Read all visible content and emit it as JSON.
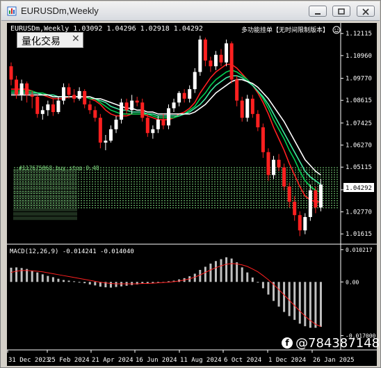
{
  "window": {
    "title": "EURUSDm,Weekly"
  },
  "chart": {
    "header": "EURUSDm,Weekly  1.03092 1.04296 1.02918 1.04292",
    "ea_label": "多功能挂单【无时间限制版本】",
    "widget_label": "量化交易",
    "widget_close": "✕",
    "price_badge": "1.04292",
    "macd_label": "MACD(12,26,9) -0.014241 -0.014040",
    "watermark": "@784387148",
    "order_label_fragments": [
      "#117675868 buy stop 0.48"
    ]
  },
  "chart_data": {
    "type": "candlestick",
    "price_axis": {
      "ticks": [
        "1.12115",
        "1.10960",
        "1.09770",
        "1.08615",
        "1.07425",
        "1.06270",
        "1.05115",
        "1.03925",
        "1.02770",
        "1.01615"
      ],
      "ylim": [
        1.0115,
        1.1245
      ]
    },
    "macd_axis": {
      "ticks": [
        "0.010217",
        "0.00",
        "-0.017000"
      ],
      "ylim": [
        -0.0215,
        0.0115
      ]
    },
    "time_axis": [
      "31 Dec 2023",
      "25 Feb 2024",
      "21 Apr 2024",
      "16 Jun 2024",
      "11 Aug 2024",
      "6 Oct 2024",
      "1 Dec 2024",
      "26 Jan 2025"
    ],
    "candles": [
      {
        "o": 1.104,
        "c": 1.097,
        "h": 1.106,
        "l": 1.094
      },
      {
        "o": 1.097,
        "c": 1.089,
        "h": 1.099,
        "l": 1.087
      },
      {
        "o": 1.089,
        "c": 1.095,
        "h": 1.097,
        "l": 1.086
      },
      {
        "o": 1.095,
        "c": 1.089,
        "h": 1.096,
        "l": 1.085
      },
      {
        "o": 1.089,
        "c": 1.088,
        "h": 1.091,
        "l": 1.082
      },
      {
        "o": 1.088,
        "c": 1.079,
        "h": 1.089,
        "l": 1.077
      },
      {
        "o": 1.079,
        "c": 1.081,
        "h": 1.083,
        "l": 1.076
      },
      {
        "o": 1.081,
        "c": 1.084,
        "h": 1.086,
        "l": 1.078
      },
      {
        "o": 1.084,
        "c": 1.08,
        "h": 1.087,
        "l": 1.078
      },
      {
        "o": 1.08,
        "c": 1.086,
        "h": 1.088,
        "l": 1.079
      },
      {
        "o": 1.086,
        "c": 1.093,
        "h": 1.095,
        "l": 1.084
      },
      {
        "o": 1.093,
        "c": 1.089,
        "h": 1.095,
        "l": 1.087
      },
      {
        "o": 1.089,
        "c": 1.087,
        "h": 1.092,
        "l": 1.085
      },
      {
        "o": 1.087,
        "c": 1.091,
        "h": 1.093,
        "l": 1.086
      },
      {
        "o": 1.091,
        "c": 1.084,
        "h": 1.092,
        "l": 1.082
      },
      {
        "o": 1.084,
        "c": 1.081,
        "h": 1.086,
        "l": 1.079
      },
      {
        "o": 1.081,
        "c": 1.077,
        "h": 1.083,
        "l": 1.075
      },
      {
        "o": 1.077,
        "c": 1.064,
        "h": 1.079,
        "l": 1.061
      },
      {
        "o": 1.064,
        "c": 1.065,
        "h": 1.068,
        "l": 1.06
      },
      {
        "o": 1.065,
        "c": 1.071,
        "h": 1.073,
        "l": 1.064
      },
      {
        "o": 1.071,
        "c": 1.076,
        "h": 1.078,
        "l": 1.069
      },
      {
        "o": 1.076,
        "c": 1.085,
        "h": 1.087,
        "l": 1.074
      },
      {
        "o": 1.085,
        "c": 1.081,
        "h": 1.087,
        "l": 1.079
      },
      {
        "o": 1.081,
        "c": 1.086,
        "h": 1.089,
        "l": 1.079
      },
      {
        "o": 1.086,
        "c": 1.085,
        "h": 1.088,
        "l": 1.083
      },
      {
        "o": 1.085,
        "c": 1.077,
        "h": 1.087,
        "l": 1.075
      },
      {
        "o": 1.077,
        "c": 1.069,
        "h": 1.079,
        "l": 1.067
      },
      {
        "o": 1.069,
        "c": 1.071,
        "h": 1.073,
        "l": 1.066
      },
      {
        "o": 1.071,
        "c": 1.076,
        "h": 1.078,
        "l": 1.069
      },
      {
        "o": 1.076,
        "c": 1.073,
        "h": 1.079,
        "l": 1.071
      },
      {
        "o": 1.073,
        "c": 1.082,
        "h": 1.084,
        "l": 1.071
      },
      {
        "o": 1.082,
        "c": 1.085,
        "h": 1.087,
        "l": 1.08
      },
      {
        "o": 1.085,
        "c": 1.09,
        "h": 1.091,
        "l": 1.083
      },
      {
        "o": 1.09,
        "c": 1.087,
        "h": 1.092,
        "l": 1.085
      },
      {
        "o": 1.087,
        "c": 1.092,
        "h": 1.094,
        "l": 1.085
      },
      {
        "o": 1.092,
        "c": 1.101,
        "h": 1.103,
        "l": 1.09
      },
      {
        "o": 1.101,
        "c": 1.118,
        "h": 1.12,
        "l": 1.099
      },
      {
        "o": 1.118,
        "c": 1.107,
        "h": 1.119,
        "l": 1.104
      },
      {
        "o": 1.107,
        "c": 1.104,
        "h": 1.109,
        "l": 1.101
      },
      {
        "o": 1.104,
        "c": 1.11,
        "h": 1.112,
        "l": 1.102
      },
      {
        "o": 1.11,
        "c": 1.106,
        "h": 1.113,
        "l": 1.104
      },
      {
        "o": 1.106,
        "c": 1.116,
        "h": 1.118,
        "l": 1.104
      },
      {
        "o": 1.116,
        "c": 1.097,
        "h": 1.117,
        "l": 1.095
      },
      {
        "o": 1.097,
        "c": 1.086,
        "h": 1.099,
        "l": 1.083
      },
      {
        "o": 1.086,
        "c": 1.077,
        "h": 1.088,
        "l": 1.075
      },
      {
        "o": 1.077,
        "c": 1.087,
        "h": 1.089,
        "l": 1.075
      },
      {
        "o": 1.087,
        "c": 1.079,
        "h": 1.089,
        "l": 1.077
      },
      {
        "o": 1.079,
        "c": 1.072,
        "h": 1.081,
        "l": 1.07
      },
      {
        "o": 1.072,
        "c": 1.059,
        "h": 1.074,
        "l": 1.056
      },
      {
        "o": 1.059,
        "c": 1.047,
        "h": 1.061,
        "l": 1.044
      },
      {
        "o": 1.047,
        "c": 1.055,
        "h": 1.057,
        "l": 1.045
      },
      {
        "o": 1.055,
        "c": 1.051,
        "h": 1.058,
        "l": 1.049
      },
      {
        "o": 1.051,
        "c": 1.041,
        "h": 1.053,
        "l": 1.039
      },
      {
        "o": 1.041,
        "c": 1.033,
        "h": 1.043,
        "l": 1.03
      },
      {
        "o": 1.033,
        "c": 1.026,
        "h": 1.036,
        "l": 1.023
      },
      {
        "o": 1.026,
        "c": 1.018,
        "h": 1.028,
        "l": 1.015
      },
      {
        "o": 1.018,
        "c": 1.025,
        "h": 1.027,
        "l": 1.016
      },
      {
        "o": 1.025,
        "c": 1.039,
        "h": 1.042,
        "l": 1.023
      },
      {
        "o": 1.039,
        "c": 1.03,
        "h": 1.041,
        "l": 1.027
      },
      {
        "o": 1.03,
        "c": 1.042,
        "h": 1.045,
        "l": 1.028
      }
    ],
    "moving_averages": [
      {
        "color": "#ff2020",
        "values": [
          1.092,
          1.092,
          1.092,
          1.092,
          1.091,
          1.09,
          1.089,
          1.088,
          1.087,
          1.087,
          1.087,
          1.088,
          1.088,
          1.088,
          1.088,
          1.087,
          1.086,
          1.084,
          1.081,
          1.079,
          1.078,
          1.078,
          1.078,
          1.079,
          1.079,
          1.079,
          1.078,
          1.077,
          1.076,
          1.076,
          1.076,
          1.077,
          1.079,
          1.08,
          1.082,
          1.085,
          1.09,
          1.094,
          1.098,
          1.101,
          1.103,
          1.105,
          1.105,
          1.103,
          1.1,
          1.097,
          1.094,
          1.09,
          1.085,
          1.079,
          1.072,
          1.066,
          1.06,
          1.053,
          1.047,
          1.041,
          1.036,
          1.034,
          1.033,
          1.033
        ]
      },
      {
        "color": "#00d050",
        "values": [
          1.091,
          1.091,
          1.091,
          1.091,
          1.091,
          1.09,
          1.09,
          1.089,
          1.088,
          1.088,
          1.088,
          1.088,
          1.088,
          1.088,
          1.088,
          1.087,
          1.087,
          1.085,
          1.083,
          1.081,
          1.08,
          1.079,
          1.079,
          1.079,
          1.079,
          1.079,
          1.079,
          1.078,
          1.077,
          1.077,
          1.077,
          1.077,
          1.078,
          1.079,
          1.081,
          1.083,
          1.087,
          1.09,
          1.094,
          1.097,
          1.099,
          1.101,
          1.102,
          1.101,
          1.099,
          1.097,
          1.094,
          1.091,
          1.087,
          1.082,
          1.076,
          1.071,
          1.066,
          1.06,
          1.055,
          1.049,
          1.044,
          1.041,
          1.039,
          1.038
        ]
      },
      {
        "color": "#40e8a0",
        "values": [
          1.09,
          1.09,
          1.09,
          1.09,
          1.09,
          1.09,
          1.089,
          1.089,
          1.089,
          1.088,
          1.088,
          1.088,
          1.088,
          1.088,
          1.088,
          1.088,
          1.087,
          1.086,
          1.085,
          1.083,
          1.082,
          1.081,
          1.081,
          1.08,
          1.08,
          1.08,
          1.079,
          1.079,
          1.078,
          1.078,
          1.078,
          1.078,
          1.078,
          1.079,
          1.08,
          1.082,
          1.084,
          1.087,
          1.091,
          1.094,
          1.096,
          1.098,
          1.099,
          1.099,
          1.098,
          1.096,
          1.094,
          1.091,
          1.088,
          1.084,
          1.079,
          1.074,
          1.069,
          1.064,
          1.059,
          1.054,
          1.049,
          1.046,
          1.044,
          1.042
        ]
      },
      {
        "color": "#ffffff",
        "values": [
          1.089,
          1.089,
          1.089,
          1.089,
          1.089,
          1.089,
          1.089,
          1.089,
          1.088,
          1.088,
          1.088,
          1.088,
          1.088,
          1.088,
          1.088,
          1.088,
          1.087,
          1.087,
          1.086,
          1.085,
          1.084,
          1.083,
          1.082,
          1.082,
          1.081,
          1.081,
          1.08,
          1.08,
          1.079,
          1.079,
          1.079,
          1.079,
          1.079,
          1.079,
          1.079,
          1.08,
          1.082,
          1.084,
          1.087,
          1.09,
          1.092,
          1.094,
          1.096,
          1.097,
          1.097,
          1.096,
          1.095,
          1.093,
          1.09,
          1.087,
          1.083,
          1.079,
          1.075,
          1.07,
          1.065,
          1.06,
          1.055,
          1.052,
          1.049,
          1.047
        ]
      }
    ],
    "macd_histogram": [
      0.0045,
      0.0046,
      0.0044,
      0.0041,
      0.0036,
      0.003,
      0.0024,
      0.0019,
      0.0015,
      0.001,
      0.0006,
      0.0004,
      0.0002,
      0.0,
      -0.0004,
      -0.0008,
      -0.0011,
      -0.0015,
      -0.0017,
      -0.0018,
      -0.0016,
      -0.0014,
      -0.0012,
      -0.001,
      -0.0008,
      -0.0006,
      -0.0005,
      -0.0004,
      -0.0002,
      0.0,
      0.0002,
      0.0004,
      0.0008,
      0.0012,
      0.0018,
      0.0026,
      0.0038,
      0.0048,
      0.0058,
      0.0066,
      0.0072,
      0.0078,
      0.0074,
      0.0062,
      0.0046,
      0.003,
      0.0014,
      -0.0002,
      -0.002,
      -0.004,
      -0.006,
      -0.0078,
      -0.0095,
      -0.0108,
      -0.012,
      -0.0132,
      -0.014,
      -0.0145,
      -0.0145,
      -0.0142
    ],
    "macd_signal": [
      0.003,
      0.0034,
      0.0036,
      0.0036,
      0.0035,
      0.0034,
      0.0032,
      0.0029,
      0.0026,
      0.0023,
      0.002,
      0.0017,
      0.0014,
      0.0011,
      0.0008,
      0.0005,
      0.0002,
      -0.0001,
      -0.0003,
      -0.0005,
      -0.0006,
      -0.0006,
      -0.0006,
      -0.0006,
      -0.0006,
      -0.0005,
      -0.0005,
      -0.0004,
      -0.0003,
      -0.0002,
      -0.0001,
      0.0001,
      0.0003,
      0.0006,
      0.001,
      0.0015,
      0.0022,
      0.003,
      0.0038,
      0.0045,
      0.0051,
      0.0056,
      0.0058,
      0.0057,
      0.0054,
      0.0049,
      0.0041,
      0.0032,
      0.002,
      0.0007,
      -0.0008,
      -0.0024,
      -0.0041,
      -0.0058,
      -0.0075,
      -0.0092,
      -0.0108,
      -0.0122,
      -0.0134,
      -0.0141
    ]
  },
  "colors": {
    "bull": "#ffffff",
    "bear": "#ff2020",
    "grid": "#3a3a3a",
    "order_lines": "#7cd67c",
    "histogram": "#c0c0c0",
    "signal": "#ff2020"
  }
}
